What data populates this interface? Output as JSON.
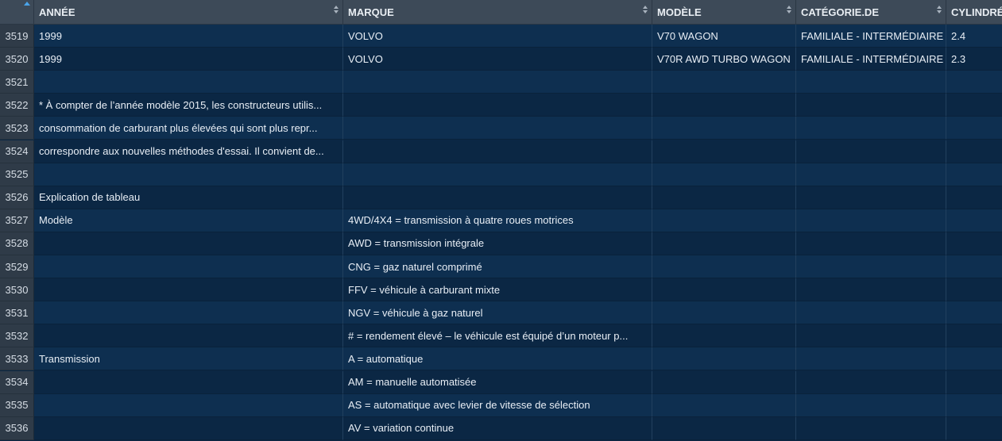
{
  "header": {
    "columns": [
      "ANNÉE",
      "MARQUE",
      "MODÈLE",
      "CATÉGORIE.DE",
      "CYLINDRÉE"
    ]
  },
  "rows": [
    {
      "num": "3519",
      "cells": [
        "1999",
        "VOLVO",
        "V70 WAGON",
        "FAMILIALE - INTERMÉDIAIRE",
        "2.4"
      ]
    },
    {
      "num": "3520",
      "cells": [
        "1999",
        "VOLVO",
        "V70R AWD TURBO WAGON",
        "FAMILIALE - INTERMÉDIAIRE",
        "2.3"
      ]
    },
    {
      "num": "3521",
      "cells": [
        "",
        "",
        "",
        "",
        ""
      ]
    },
    {
      "num": "3522",
      "cells": [
        "* À compter de l’année modèle 2015, les constructeurs utilis...",
        "",
        "",
        "",
        ""
      ]
    },
    {
      "num": "3523",
      "cells": [
        "consommation de carburant plus élevées qui sont plus repr...",
        "",
        "",
        "",
        ""
      ]
    },
    {
      "num": "3524",
      "cells": [
        "correspondre aux nouvelles méthodes d'essai. Il convient de...",
        "",
        "",
        "",
        ""
      ]
    },
    {
      "num": "3525",
      "cells": [
        "",
        "",
        "",
        "",
        ""
      ]
    },
    {
      "num": "3526",
      "cells": [
        "Explication de tableau",
        "",
        "",
        "",
        ""
      ]
    },
    {
      "num": "3527",
      "cells": [
        "Modèle",
        "4WD/4X4 = transmission à quatre roues motrices",
        "",
        "",
        ""
      ]
    },
    {
      "num": "3528",
      "cells": [
        "",
        "AWD = transmission intégrale",
        "",
        "",
        ""
      ]
    },
    {
      "num": "3529",
      "cells": [
        "",
        "CNG = gaz naturel comprimé",
        "",
        "",
        ""
      ]
    },
    {
      "num": "3530",
      "cells": [
        "",
        "FFV = véhicule à carburant mixte",
        "",
        "",
        ""
      ]
    },
    {
      "num": "3531",
      "cells": [
        "",
        "NGV = véhicule à gaz naturel",
        "",
        "",
        ""
      ]
    },
    {
      "num": "3532",
      "cells": [
        "",
        "# = rendement élevé – le véhicule est équipé d’un moteur p...",
        "",
        "",
        ""
      ]
    },
    {
      "num": "3533",
      "cells": [
        "Transmission",
        "A = automatique",
        "",
        "",
        ""
      ]
    },
    {
      "num": "3534",
      "cells": [
        "",
        "AM = manuelle automatisée",
        "",
        "",
        ""
      ]
    },
    {
      "num": "3535",
      "cells": [
        "",
        "AS = automatique avec levier de vitesse de sélection",
        "",
        "",
        ""
      ]
    },
    {
      "num": "3536",
      "cells": [
        "",
        "AV = variation continue",
        "",
        "",
        ""
      ]
    }
  ],
  "colors": {
    "header_bg": "#3d4a58",
    "row_odd": "#0b2744",
    "row_even": "#0e2f50",
    "sort_active": "#4aa3e8"
  }
}
